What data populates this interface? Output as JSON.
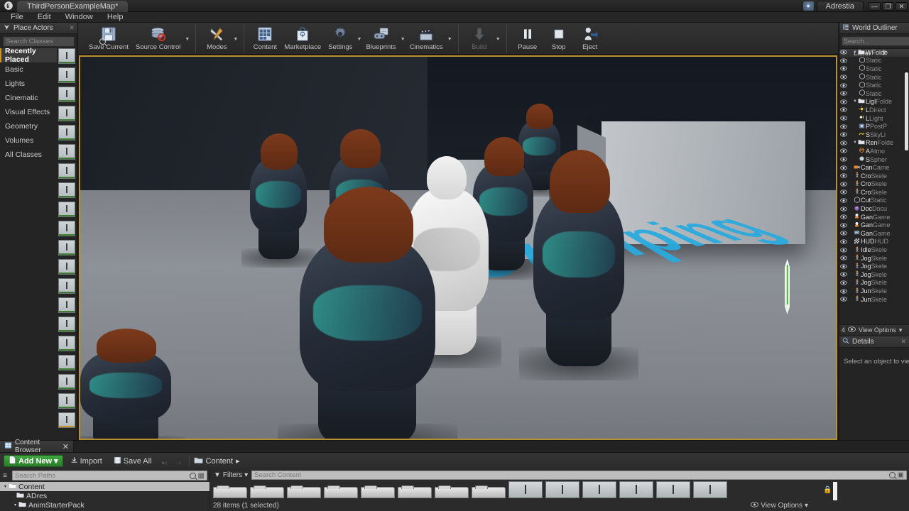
{
  "titlebar": {
    "logo_icon": "unreal-logo-icon",
    "map_tab": "ThirdPersonExampleMap*",
    "account_icon": "account-avatar-icon",
    "account_name": "Adrestia",
    "minimize": "—",
    "maximize": "❐",
    "close": "✕"
  },
  "menubar": {
    "items": [
      "File",
      "Edit",
      "Window",
      "Help"
    ]
  },
  "toolbar": {
    "groups": [
      {
        "buttons": [
          {
            "label": "Save Current",
            "icon": "save-icon",
            "caret": false,
            "disabled": false
          },
          {
            "label": "Source Control",
            "icon": "source-control-icon",
            "caret": true,
            "disabled": false
          }
        ]
      },
      {
        "buttons": [
          {
            "label": "Modes",
            "icon": "modes-wrench-icon",
            "caret": true,
            "disabled": false
          }
        ]
      },
      {
        "buttons": [
          {
            "label": "Content",
            "icon": "content-grid-icon",
            "caret": false,
            "disabled": false
          },
          {
            "label": "Marketplace",
            "icon": "marketplace-bag-icon",
            "caret": false,
            "disabled": false
          },
          {
            "label": "Settings",
            "icon": "settings-gear-icon",
            "caret": true,
            "disabled": false
          },
          {
            "label": "Blueprints",
            "icon": "blueprints-icon",
            "caret": true,
            "disabled": false
          },
          {
            "label": "Cinematics",
            "icon": "cinematics-clapperboard-icon",
            "caret": true,
            "disabled": false
          }
        ]
      },
      {
        "buttons": [
          {
            "label": "Build",
            "icon": "build-icon",
            "caret": true,
            "disabled": true
          }
        ]
      },
      {
        "buttons": [
          {
            "label": "Pause",
            "icon": "pause-icon",
            "caret": false,
            "disabled": false
          },
          {
            "label": "Stop",
            "icon": "stop-icon",
            "caret": false,
            "disabled": false
          },
          {
            "label": "Eject",
            "icon": "eject-person-icon",
            "caret": false,
            "disabled": false
          }
        ]
      }
    ]
  },
  "place_actors": {
    "tab_title": "Place Actors",
    "tab_icon": "place-actors-icon",
    "close_icon": "close-icon",
    "search_placeholder": "Search Classes",
    "search_value": "",
    "categories": [
      {
        "label": "Recently Placed",
        "active": true
      },
      {
        "label": "Basic",
        "active": false
      },
      {
        "label": "Lights",
        "active": false
      },
      {
        "label": "Cinematic",
        "active": false
      },
      {
        "label": "Visual Effects",
        "active": false
      },
      {
        "label": "Geometry",
        "active": false
      },
      {
        "label": "Volumes",
        "active": false
      },
      {
        "label": "All Classes",
        "active": false
      }
    ],
    "thumbnails": [
      {
        "selected": false
      },
      {
        "selected": false
      },
      {
        "selected": false
      },
      {
        "selected": false
      },
      {
        "selected": false
      },
      {
        "selected": false
      },
      {
        "selected": false
      },
      {
        "selected": false
      },
      {
        "selected": false
      },
      {
        "selected": false
      },
      {
        "selected": false
      },
      {
        "selected": false
      },
      {
        "selected": false
      },
      {
        "selected": false
      },
      {
        "selected": false
      },
      {
        "selected": false
      },
      {
        "selected": false
      },
      {
        "selected": false
      },
      {
        "selected": false
      },
      {
        "selected": true
      }
    ]
  },
  "viewport": {
    "border_color": "#b8922e",
    "floor_text": "Jumping",
    "floor_text_color": "#29a9de",
    "marker_color": "#35c035",
    "is_playing_in_editor": true
  },
  "world_outliner": {
    "tab_title": "World Outliner",
    "tab_icon": "world-outliner-icon",
    "search_placeholder": "Search...",
    "search_value": "",
    "add_icon": "add-actor-icon",
    "col_label": "Label",
    "col_type": "T",
    "sort_icon": "sort-caret-icon",
    "rows": [
      {
        "indent": 1,
        "expander": true,
        "icon": "folder-icon",
        "name": "WFolde",
        "suffix": ""
      },
      {
        "indent": 2,
        "expander": false,
        "icon": "static-mesh-icon",
        "name": "",
        "suffix": "Static"
      },
      {
        "indent": 2,
        "expander": false,
        "icon": "static-mesh-icon",
        "name": "",
        "suffix": "Static"
      },
      {
        "indent": 2,
        "expander": false,
        "icon": "static-mesh-icon",
        "name": "",
        "suffix": "Static"
      },
      {
        "indent": 2,
        "expander": false,
        "icon": "static-mesh-icon",
        "name": "",
        "suffix": "Static"
      },
      {
        "indent": 2,
        "expander": false,
        "icon": "static-mesh-icon",
        "name": "",
        "suffix": "Static"
      },
      {
        "indent": 1,
        "expander": true,
        "icon": "folder-icon",
        "name": "LigI",
        "suffix": "Folde"
      },
      {
        "indent": 2,
        "expander": false,
        "icon": "directional-light-icon",
        "name": "L",
        "suffix": "Direct"
      },
      {
        "indent": 2,
        "expander": false,
        "icon": "light-icon",
        "name": "L",
        "suffix": "Light"
      },
      {
        "indent": 2,
        "expander": false,
        "icon": "postprocess-icon",
        "name": "P",
        "suffix": "PostP"
      },
      {
        "indent": 2,
        "expander": false,
        "icon": "skylight-icon",
        "name": "S",
        "suffix": "SkyLi"
      },
      {
        "indent": 1,
        "expander": true,
        "icon": "folder-icon",
        "name": "Ren",
        "suffix": "Folde"
      },
      {
        "indent": 2,
        "expander": false,
        "icon": "atmosphere-icon",
        "name": "A",
        "suffix": "Atmo"
      },
      {
        "indent": 2,
        "expander": false,
        "icon": "sphere-icon",
        "name": "S",
        "suffix": "Spher"
      },
      {
        "indent": 1,
        "expander": false,
        "icon": "camera-icon",
        "name": "Can",
        "suffix": "Came"
      },
      {
        "indent": 1,
        "expander": false,
        "icon": "skeletal-mesh-icon",
        "name": "Cro",
        "suffix": "Skele"
      },
      {
        "indent": 1,
        "expander": false,
        "icon": "skeletal-mesh-icon",
        "name": "Cro",
        "suffix": "Skele"
      },
      {
        "indent": 1,
        "expander": false,
        "icon": "skeletal-mesh-icon",
        "name": "Cro",
        "suffix": "Skele"
      },
      {
        "indent": 1,
        "expander": false,
        "icon": "static-mesh-icon",
        "name": "Cut",
        "suffix": "Static"
      },
      {
        "indent": 1,
        "expander": false,
        "icon": "document-icon",
        "name": "Doc",
        "suffix": "Docu"
      },
      {
        "indent": 1,
        "expander": false,
        "icon": "gamemode-icon",
        "name": "Gan",
        "suffix": "Game"
      },
      {
        "indent": 1,
        "expander": false,
        "icon": "gamemode-icon",
        "name": "Gan",
        "suffix": "Game"
      },
      {
        "indent": 1,
        "expander": false,
        "icon": "gamestate-icon",
        "name": "Gan",
        "suffix": "Game"
      },
      {
        "indent": 1,
        "expander": false,
        "icon": "hud-icon",
        "name": "HUD",
        "suffix": "HUD"
      },
      {
        "indent": 1,
        "expander": false,
        "icon": "skeletal-mesh-icon",
        "name": "Idle",
        "suffix": "Skele"
      },
      {
        "indent": 1,
        "expander": false,
        "icon": "skeletal-mesh-icon",
        "name": "Jog",
        "suffix": "Skele"
      },
      {
        "indent": 1,
        "expander": false,
        "icon": "skeletal-mesh-icon",
        "name": "Jog",
        "suffix": "Skele"
      },
      {
        "indent": 1,
        "expander": false,
        "icon": "skeletal-mesh-icon",
        "name": "Jog",
        "suffix": "Skele"
      },
      {
        "indent": 1,
        "expander": false,
        "icon": "skeletal-mesh-icon",
        "name": "Jog",
        "suffix": "Skele"
      },
      {
        "indent": 1,
        "expander": false,
        "icon": "skeletal-mesh-icon",
        "name": "Jun",
        "suffix": "Skele"
      },
      {
        "indent": 1,
        "expander": false,
        "icon": "skeletal-mesh-icon",
        "name": "Jun",
        "suffix": "Skele"
      }
    ],
    "footer_count": "4",
    "footer_eye_icon": "eye-icon",
    "footer_label": "View Options",
    "footer_caret": "▾"
  },
  "details": {
    "tab_title": "Details",
    "tab_icon": "details-icon",
    "close_icon": "close-icon",
    "empty_message": "Select an object to view de"
  },
  "content_browser": {
    "tab_title": "Content Browser",
    "tab_icon": "content-browser-icon",
    "close_icon": "close-icon",
    "add_new_label": "Add New",
    "add_new_icon": "add-new-file-icon",
    "add_new_caret": "▾",
    "import_label": "Import",
    "import_icon": "import-icon",
    "save_all_label": "Save All",
    "save_all_icon": "save-all-icon",
    "back_icon": "back-arrow-icon",
    "forward_icon": "forward-arrow-icon",
    "breadcrumb_icon": "folder-open-icon",
    "breadcrumb_root": "Content",
    "breadcrumb_caret": "▸",
    "paths_search_placeholder": "Search Paths",
    "paths_search_value": "",
    "paths_filter_icon": "path-filter-icon",
    "paths_settings_icon": "paths-settings-icon",
    "tree": [
      {
        "label": "Content",
        "indent": 0,
        "expander": "▾",
        "selected": true
      },
      {
        "label": "ADres",
        "indent": 1,
        "expander": "",
        "selected": false
      },
      {
        "label": "AnimStarterPack",
        "indent": 1,
        "expander": "▾",
        "selected": false
      }
    ],
    "filters_label": "Filters",
    "filters_icon": "filter-funnel-icon",
    "filters_caret": "▾",
    "content_search_placeholder": "Search Content",
    "content_search_value": "",
    "content_search_icon": "search-icon",
    "content_save_icon": "save-search-icon",
    "folder_tiles": 8,
    "asset_tiles": 6,
    "status_text": "28 items (1 selected)",
    "view_options_label": "View Options",
    "view_options_icon": "eye-icon",
    "view_options_caret": "▾",
    "lock_icon": "lock-icon"
  }
}
